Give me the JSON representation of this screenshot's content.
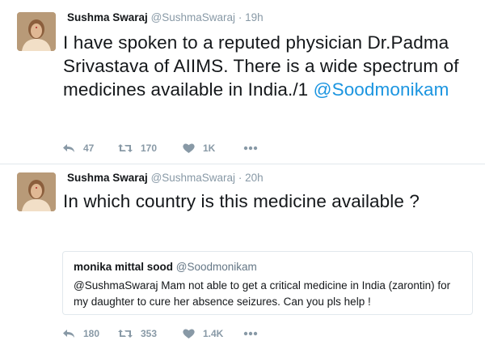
{
  "tweets": [
    {
      "name": "Sushma Swaraj",
      "handle": "@SushmaSwaraj",
      "dot": "·",
      "time": "19h",
      "text": "I have spoken to a reputed physician Dr.Padma Srivastava of AIIMS. There is a wide spectrum of medicines available in India./1 ",
      "mention": "@Soodmonikam",
      "replies": "47",
      "retweets": "170",
      "likes": "1K"
    },
    {
      "name": "Sushma Swaraj",
      "handle": "@SushmaSwaraj",
      "dot": "·",
      "time": "20h",
      "text": "In which country is this medicine available ?",
      "replies": "180",
      "retweets": "353",
      "likes": "1.4K",
      "quote": {
        "name": "monika mittal sood",
        "handle": "@Soodmonikam",
        "text": "@SushmaSwaraj Mam not able to get a critical medicine in India (zarontin) for my daughter to cure her absence seizures. Can you pls help !"
      }
    }
  ],
  "colors": {
    "text": "#14171a",
    "muted": "#8899a6",
    "link": "#1b95e0",
    "border": "#e1e8ed"
  },
  "icons": [
    "avatar",
    "reply-icon",
    "retweet-icon",
    "like-icon",
    "more-icon"
  ]
}
